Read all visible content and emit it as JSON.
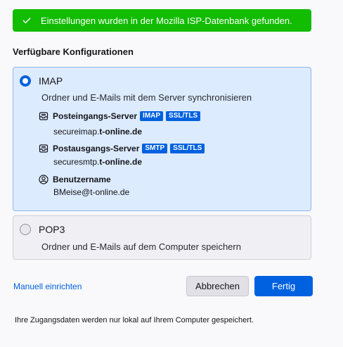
{
  "banner": {
    "text": "Einstellungen wurden in der Mozilla ISP-Datenbank gefunden.",
    "icon": "check-icon",
    "color": "#12bc00"
  },
  "section_title": "Verfügbare Konfigurationen",
  "imap": {
    "label": "IMAP",
    "selected": true,
    "description": "Ordner und E-Mails mit dem Server synchronisieren",
    "incoming": {
      "label": "Posteingangs-Server",
      "badges": [
        "IMAP",
        "SSL/TLS"
      ],
      "host_prefix": "secureimap.",
      "host_domain": "t-online.de",
      "icon": "inbox-icon"
    },
    "outgoing": {
      "label": "Postausgangs-Server",
      "badges": [
        "SMTP",
        "SSL/TLS"
      ],
      "host_prefix": "securesmtp.",
      "host_domain": "t-online.de",
      "icon": "outbox-icon"
    },
    "username": {
      "label": "Benutzername",
      "value": "BMeise@t-online.de",
      "icon": "user-icon"
    }
  },
  "pop3": {
    "label": "POP3",
    "selected": false,
    "description": "Ordner und E-Mails auf dem Computer speichern"
  },
  "actions": {
    "manual_link": "Manuell einrichten",
    "cancel": "Abbrechen",
    "done": "Fertig"
  },
  "footer": "Ihre Zugangsdaten werden nur lokal auf Ihrem Computer gespeichert.",
  "colors": {
    "accent": "#0061e0",
    "selected_card_bg": "#dcebfd",
    "success": "#12bc00"
  }
}
